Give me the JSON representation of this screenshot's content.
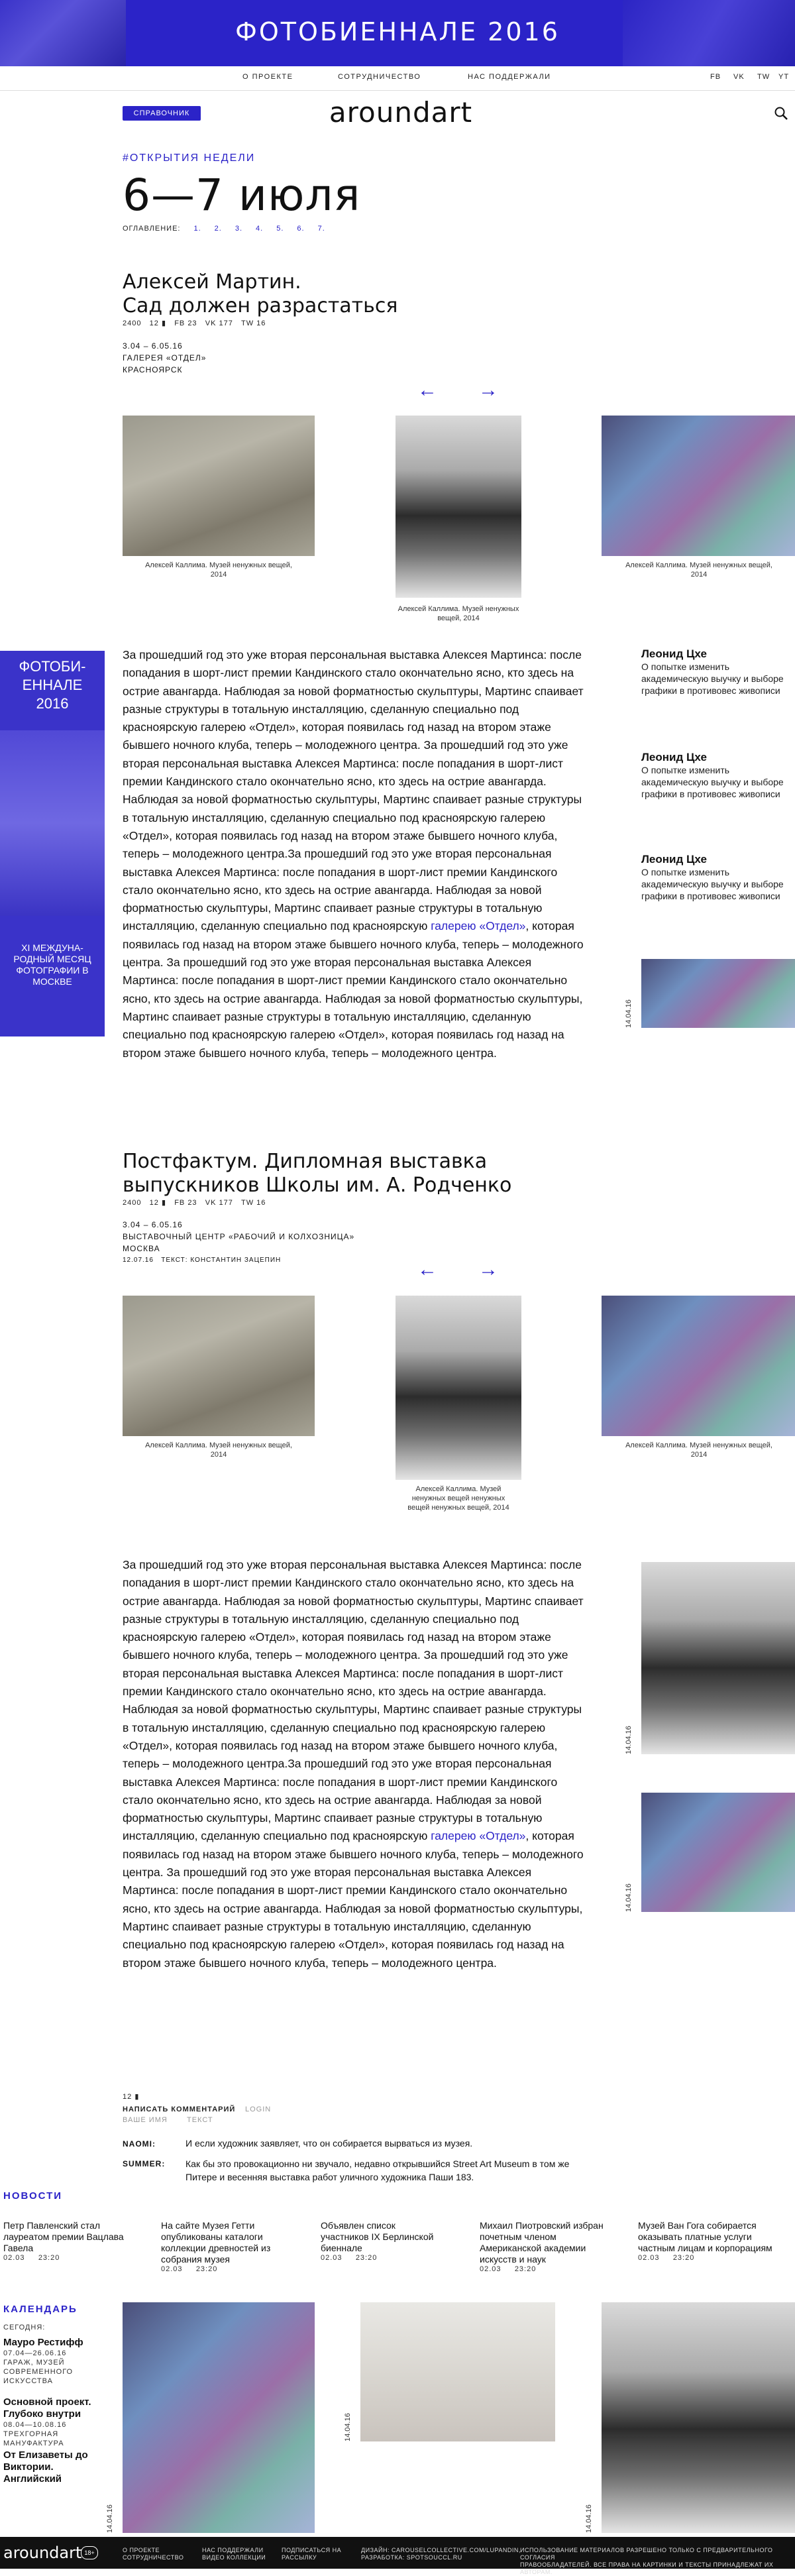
{
  "banner": {
    "text": "ФОТОБИЕННАЛЕ 2016"
  },
  "nav": {
    "items": [
      "О ПРОЕКТЕ",
      "СОТРУДНИЧЕСТВО",
      "НАС ПОДДЕРЖАЛИ"
    ],
    "social": [
      "FB",
      "VK",
      "TW",
      "YT"
    ]
  },
  "header": {
    "badge": "СПРАВОЧНИК",
    "logo": "aroundart"
  },
  "page": {
    "hashtag": "#ОТКРЫТИЯ НЕДЕЛИ",
    "title": "6—7 июля",
    "toc_label": "ОГЛАВЛЕНИЕ:",
    "toc": [
      "1.",
      "2.",
      "3.",
      "4.",
      "5.",
      "6.",
      "7."
    ]
  },
  "article1": {
    "title_line1": "Алексей Мартин.",
    "title_line2": "Сад должен разрастаться",
    "stats": {
      "views": "2400",
      "comments": "12",
      "fb": "FB 23",
      "vk": "VK 177",
      "tw": "TW 16"
    },
    "dates": "3.04 – 6.05.16",
    "venue": "ГАЛЕРЕЯ «ОТДЕЛ»",
    "city": "КРАСНОЯРСК",
    "captions": [
      "Алексей Каллима. Музей ненужных вещей, 2014",
      "Алексей Каллима. Музей ненужных вещей, 2014",
      "Алексей Каллима. Музей ненужных вещей, 2014"
    ],
    "text_before_link": "За прошедший год это уже вторая персональная выставка Алексея Мартинса: после попадания в шорт-лист премии Кандинского стало окончательно ясно, кто здесь на острие авангарда. Наблюдая за новой форматностью скульптуры, Мартинс спаивает разные структуры в тотальную инсталляцию, сделанную специально под красноярскую галерею «Отдел», которая появилась год назад на втором этаже бывшего ночного клуба, теперь – молодежного центра. За прошедший год это уже вторая персональная выставка Алексея Мартинса: после попадания в шорт-лист премии Кандинского стало окончательно ясно, кто здесь на острие авангарда. Наблюдая за новой форматностью скульптуры, Мартинс спаивает разные структуры в тотальную инсталляцию, сделанную специально под красноярскую галерею «Отдел», которая появилась год назад на втором этаже бывшего ночного клуба, теперь – молодежного центра.За прошедший год это уже вторая персональная выставка Алексея Мартинса: после попадания в шорт-лист премии Кандинского стало окончательно ясно, кто здесь на острие авангарда. Наблюдая за новой форматностью скульптуры, Мартинс спаивает разные структуры в тотальную инсталляцию, сделанную специально под красноярскую ",
    "link": "галерею «Отдел»",
    "text_after_link": ", которая появилась год назад на втором этаже бывшего ночного клуба, теперь – молодежного центра. За прошедший год это уже вторая персональная выставка Алексея Мартинса: после попадания в шорт-лист премии Кандинского стало окончательно ясно, кто здесь на острие авангарда. Наблюдая за новой форматностью скульптуры, Мартинс спаивает разные структуры в тотальную инсталляцию, сделанную специально под красноярскую галерею «Отдел», которая появилась год назад на втором этаже бывшего ночного клуба, теперь – молодежного центра.",
    "side": [
      {
        "author": "Леонид Цхе",
        "desc": "О попытке изменить академическую выучку и выборе графики в противовес живописи"
      },
      {
        "author": "Леонид Цхе",
        "desc": "О попытке изменить академическую выучку и выборе графики в противовес живописи"
      },
      {
        "author": "Леонид Цхе",
        "desc": "О попытке изменить академическую выучку и выборе графики в противовес живописи"
      }
    ],
    "side_date": "14.04.16"
  },
  "ad": {
    "top": "ФОТОБИ-ЕННАЛЕ 2016",
    "bottom": "XI МЕЖДУНА-РОДНЫЙ МЕСЯЦ ФОТОГРАФИИ В МОСКВЕ"
  },
  "article2": {
    "title_line1": "Постфактум. Дипломная выставка",
    "title_line2": "выпускников Школы им. А. Родченко",
    "stats": {
      "views": "2400",
      "comments": "12",
      "fb": "FB 23",
      "vk": "VK 177",
      "tw": "TW 16"
    },
    "dates": "3.04 – 6.05.16",
    "venue": "ВЫСТАВОЧНЫЙ ЦЕНТР «РАБОЧИЙ И КОЛХОЗНИЦА»",
    "city": "МОСКВА",
    "published": "12.07.16",
    "text_by": "ТЕКСТ: КОНСТАНТИН ЗАЦЕПИН",
    "captions": [
      "Алексей Каллима. Музей ненужных вещей, 2014",
      "Алексей Каллима. Музей ненужных вещей ненужных вещей ненужных вещей, 2014",
      "Алексей Каллима. Музей ненужных вещей, 2014"
    ],
    "text_before_link": "За прошедший год это уже вторая персональная выставка Алексея Мартинса: после попадания в шорт-лист премии Кандинского стало окончательно ясно, кто здесь на острие авангарда. Наблюдая за новой форматностью скульптуры, Мартинс спаивает разные структуры в тотальную инсталляцию, сделанную специально под красноярскую галерею «Отдел», которая появилась год назад на втором этаже бывшего ночного клуба, теперь – молодежного центра. За прошедший год это уже вторая персональная выставка Алексея Мартинса: после попадания в шорт-лист премии Кандинского стало окончательно ясно, кто здесь на острие авангарда. Наблюдая за новой форматностью скульптуры, Мартинс спаивает разные структуры в тотальную инсталляцию, сделанную специально под красноярскую галерею «Отдел», которая появилась год назад на втором этаже бывшего ночного клуба, теперь – молодежного центра.За прошедший год это уже вторая персональная выставка Алексея Мартинса: после попадания в шорт-лист премии Кандинского стало окончательно ясно, кто здесь на острие авангарда. Наблюдая за новой форматностью скульптуры, Мартинс спаивает разные структуры в тотальную инсталляцию, сделанную специально под красноярскую ",
    "link": "галерею «Отдел»",
    "text_after_link": ", которая появилась год назад на втором этаже бывшего ночного клуба, теперь – молодежного центра. За прошедший год это уже вторая персональная выставка Алексея Мартинса: после попадания в шорт-лист премии Кандинского стало окончательно ясно, кто здесь на острие авангарда. Наблюдая за новой форматностью скульптуры, Мартинс спаивает разные структуры в тотальную инсталляцию, сделанную специально под красноярскую галерею «Отдел», которая появилась год назад на втором этаже бывшего ночного клуба, теперь – молодежного центра.",
    "side_dates": [
      "14.04.16",
      "14.04.16"
    ]
  },
  "comments": {
    "count": "12",
    "write_label": "НАПИСАТЬ КОММЕНТАРИЙ",
    "login_label": "LOGIN",
    "name_placeholder": "ВАШЕ ИМЯ",
    "text_placeholder": "ТЕКСТ",
    "items": [
      {
        "author": "NAOMI:",
        "text": "И если художник заявляет, что он собирается вырваться из музея."
      },
      {
        "author": "SUMMER:",
        "text": "Как бы это провокационно ни звучало, недавно открывшийся Street Art Museum в том же Питере и весенняя выставка работ уличного художника Паши 183."
      }
    ]
  },
  "news": {
    "heading": "НОВОСТИ",
    "items": [
      {
        "title": "Петр Павленский стал лауреатом премии Вацлава Гавела",
        "date": "02.03",
        "time": "23:20"
      },
      {
        "title": "На сайте Музея Гетти опубликованы каталоги коллекции древностей из собрания музея",
        "date": "02.03",
        "time": "23:20"
      },
      {
        "title": "Объявлен список участников IX Берлинской биеннале",
        "date": "02.03",
        "time": "23:20"
      },
      {
        "title": "Михаил Пиотровский избран почетным членом Американской академии искусств и наук",
        "date": "02.03",
        "time": "23:20"
      },
      {
        "title": "Музей Ван Гога собирается оказывать платные услуги частным лицам и корпорациям",
        "date": "02.03",
        "time": "23:20"
      }
    ]
  },
  "calendar": {
    "heading": "КАЛЕНДАРЬ",
    "today": "СЕГОДНЯ:",
    "events": [
      {
        "title": "Мауро Рестифф",
        "dates": "07.04—26.06.16",
        "venue": "ГАРАЖ, МУЗЕЙ СОВРЕМЕННОГО ИСКУССТВА"
      },
      {
        "title": "Основной проект. Глубоко внутри",
        "dates": "08.04—10.08.16",
        "venue": "ТРЕХГОРНАЯ МАНУФАКТУРА"
      },
      {
        "title": "От Елизаветы до Виктории. Английский",
        "dates": "",
        "venue": ""
      }
    ],
    "photo_dates": [
      "14.04.16",
      "14.04.16",
      "14.04.16"
    ]
  },
  "footer": {
    "logo": "aroundart",
    "age": "18+",
    "col1": "О ПРОЕКТЕ\nСОТРУДНИЧЕСТВО",
    "col2": "НАС ПОДДЕРЖАЛИ\nВИДЕО КОЛЛЕКЦИИ",
    "col3": "ПОДПИСАТЬСЯ НА\nРАССЫЛКУ",
    "col4": "ДИЗАЙН: CAROUSELCOLLECTIVE.COM/LUPANDIN,\nРАЗРАБОТКА: SPOTSOUCCL.RU",
    "col5": "ИСПОЛЬЗОВАНИЕ МАТЕРИАЛОВ РАЗРЕШЕНО ТОЛЬКО С ПРЕДВАРИТЕЛЬНОГО СОГЛАСИЯ\nПРАВООБЛАДАТЕЛЕЙ. ВСЕ ПРАВА НА КАРТИНКИ И ТЕКСТЫ ПРИНАДЛЕЖАТ ИХ АВТОРАМ."
  },
  "colors": {
    "accent": "#2b23c8",
    "footer_bg": "#111111"
  }
}
